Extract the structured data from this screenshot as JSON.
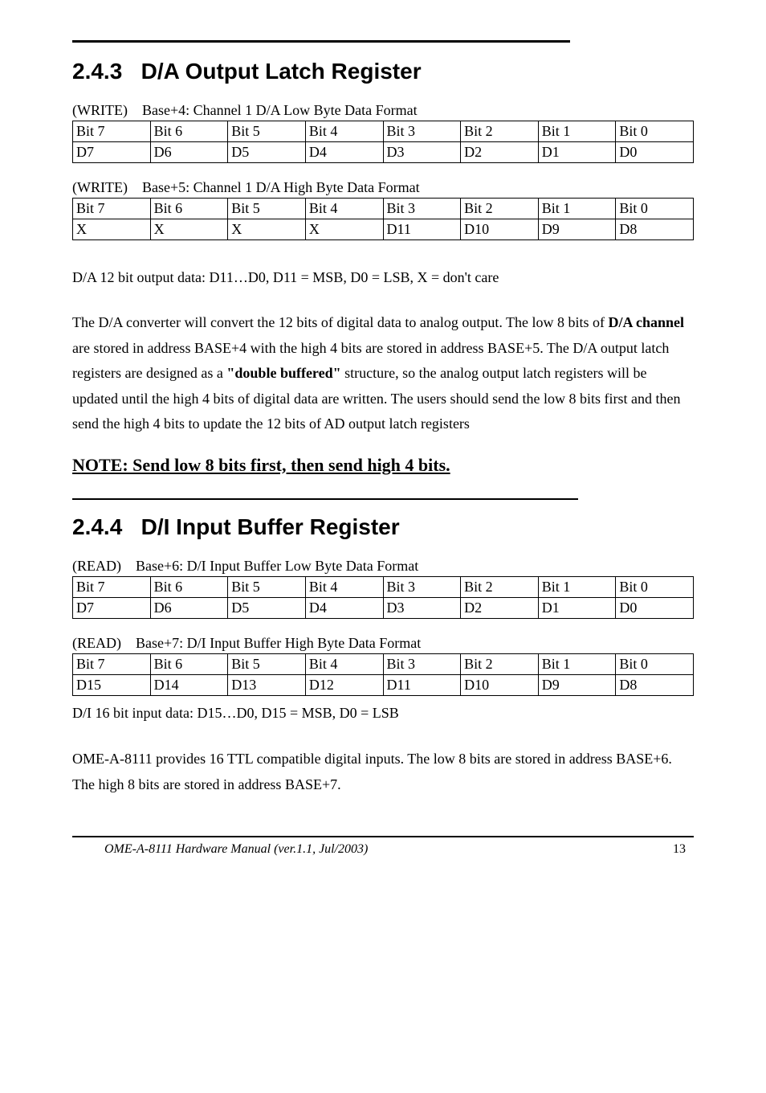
{
  "section_243": {
    "number": "2.4.3",
    "title": "D/A Output Latch Register",
    "table1_caption_prefix": "(WRITE)",
    "table1_caption": "Base+4: Channel 1 D/A Low Byte Data Format",
    "table1": {
      "header": [
        "Bit 7",
        "Bit 6",
        "Bit 5",
        "Bit 4",
        "Bit 3",
        "Bit 2",
        "Bit 1",
        "Bit 0"
      ],
      "row": [
        "D7",
        "D6",
        "D5",
        "D4",
        "D3",
        "D2",
        "D1",
        "D0"
      ]
    },
    "table2_caption_prefix": "(WRITE)",
    "table2_caption": "Base+5: Channel 1 D/A High Byte Data Format",
    "table2": {
      "header": [
        "Bit 7",
        "Bit 6",
        "Bit 5",
        "Bit 4",
        "Bit 3",
        "Bit 2",
        "Bit 1",
        "Bit 0"
      ],
      "row": [
        "X",
        "X",
        "X",
        "X",
        "D11",
        "D10",
        "D9",
        "D8"
      ]
    },
    "data_note": "D/A 12 bit output data: D11…D0, D11 = MSB, D0 = LSB, X = don't care",
    "para_pre": "The D/A converter will convert the 12 bits of digital data to analog output. The low 8 bits of ",
    "para_b1": "D/A channel",
    "para_mid1": " are stored in address BASE+4 with the high 4 bits are stored in address BASE+5. The D/A output latch registers are designed as a ",
    "para_b2": "\"double buffered\"",
    "para_post": " structure, so the analog output latch registers will be updated until the high 4 bits of digital data are written. The users should send the low 8 bits first and then send the high 4 bits to update the 12 bits of AD output latch registers",
    "note_heading": "NOTE: Send low 8 bits first, then send high 4 bits."
  },
  "section_244": {
    "number": "2.4.4",
    "title": "D/I Input Buffer Register",
    "table1_caption_prefix": "(READ)",
    "table1_caption": "Base+6: D/I Input Buffer Low Byte Data Format",
    "table1": {
      "header": [
        "Bit 7",
        "Bit 6",
        "Bit 5",
        "Bit 4",
        "Bit 3",
        "Bit 2",
        "Bit 1",
        "Bit 0"
      ],
      "row": [
        "D7",
        "D6",
        "D5",
        "D4",
        "D3",
        "D2",
        "D1",
        "D0"
      ]
    },
    "table2_caption_prefix": "(READ)",
    "table2_caption": "Base+7: D/I Input Buffer High Byte Data Format",
    "table2": {
      "header": [
        "Bit 7",
        "Bit 6",
        "Bit 5",
        "Bit 4",
        "Bit 3",
        "Bit 2",
        "Bit 1",
        "Bit 0"
      ],
      "row": [
        "D15",
        "D14",
        "D13",
        "D12",
        "D11",
        "D10",
        "D9",
        "D8"
      ]
    },
    "data_note": "D/I 16 bit input data: D15…D0, D15 = MSB, D0 = LSB",
    "para": "OME-A-8111 provides 16 TTL compatible digital inputs. The low 8 bits are stored in address BASE+6. The high 8 bits are stored in address BASE+7."
  },
  "footer": {
    "doc_title": "OME-A-8111 Hardware Manual (ver.1.1, Jul/2003)",
    "page_num": "13"
  }
}
